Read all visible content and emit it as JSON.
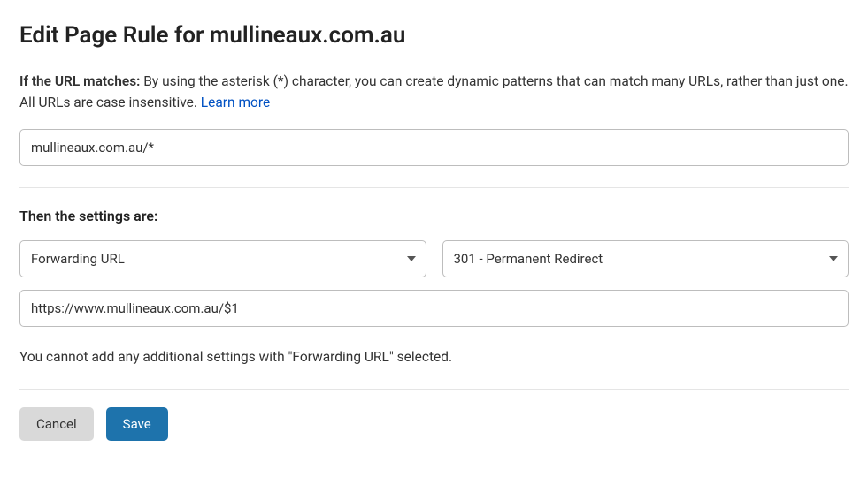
{
  "title": "Edit Page Rule for mullineaux.com.au",
  "match": {
    "label": "If the URL matches:",
    "help": "By using the asterisk (*) character, you can create dynamic patterns that can match many URLs, rather than just one. All URLs are case insensitive.",
    "learn_more": "Learn more",
    "url_value": "mullineaux.com.au/*"
  },
  "settings": {
    "heading": "Then the settings are:",
    "setting_select": "Forwarding URL",
    "status_select": "301 - Permanent Redirect",
    "destination_value": "https://www.mullineaux.com.au/$1",
    "note": "You cannot add any additional settings with \"Forwarding URL\" selected."
  },
  "buttons": {
    "cancel": "Cancel",
    "save": "Save"
  }
}
